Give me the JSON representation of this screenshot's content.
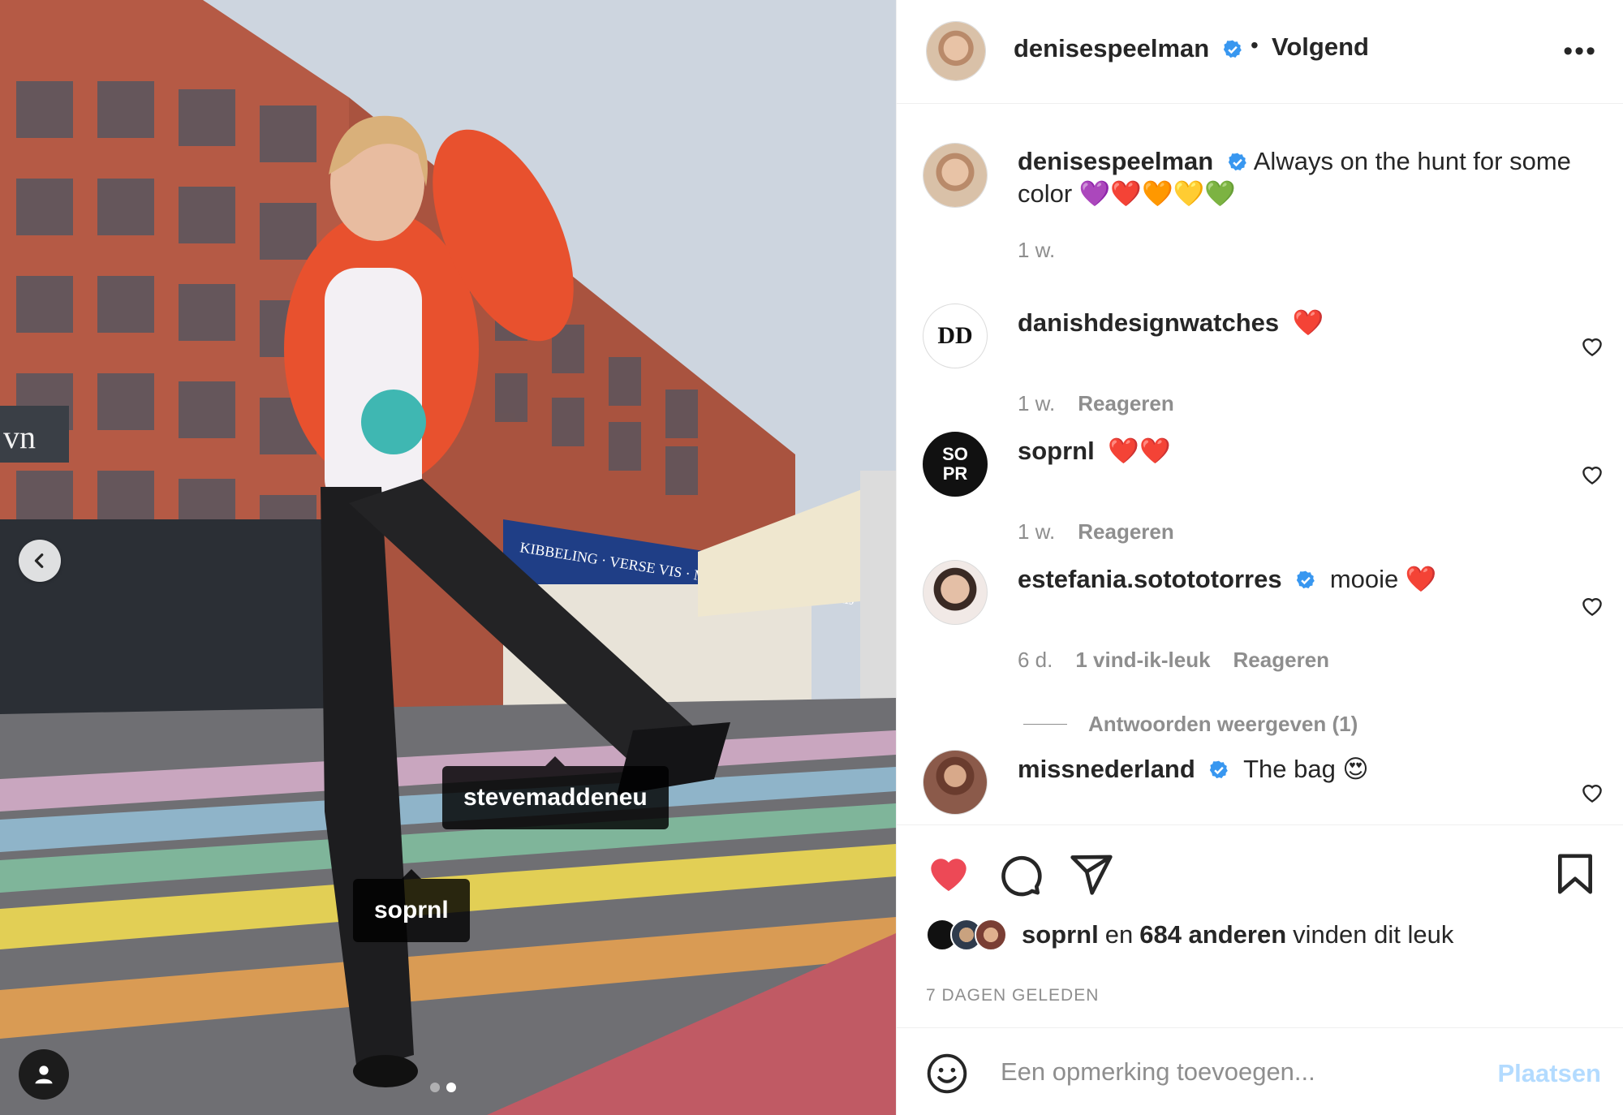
{
  "post": {
    "author": "denisespeelman",
    "follow_label": "Volgend",
    "separator": "•",
    "more_label": "•••",
    "caption_text": "Always on the hunt for some color 💜❤️🧡💛💚",
    "caption_time": "1 w."
  },
  "photo": {
    "tags": [
      "stevemaddeneu",
      "soprnl"
    ],
    "dots_count": 2,
    "active_dot": 2,
    "storefront_text": "KIBBELING · VERSE VIS · MAALTIJDEN · ROKERIJ"
  },
  "comments": [
    {
      "user": "danishdesignwatches",
      "text": "❤️",
      "verified": false,
      "time": "1 w.",
      "likes": "",
      "reply": "Reageren",
      "avatar_text": "DD"
    },
    {
      "user": "soprnl",
      "text": "❤️❤️",
      "verified": false,
      "time": "1 w.",
      "likes": "",
      "reply": "Reageren",
      "avatar_text": "SO PR"
    },
    {
      "user": "estefania.sotototorres",
      "text": "mooie ❤️",
      "verified": true,
      "time": "6 d.",
      "likes": "1 vind-ik-leuk",
      "reply": "Reageren",
      "avatar_text": ""
    },
    {
      "user": "missnederland",
      "text": "The bag 😍",
      "verified": true,
      "time": "",
      "likes": "",
      "reply": "",
      "avatar_text": ""
    }
  ],
  "view_replies": "Antwoorden weergeven (1)",
  "likes": {
    "first_user": "soprnl",
    "connector": "en",
    "others": "684 anderen",
    "suffix": "vinden dit leuk"
  },
  "timestamp": "7 DAGEN GELEDEN",
  "add_comment": {
    "placeholder": "Een opmerking toevoegen...",
    "post_label": "Plaatsen"
  },
  "colors": {
    "like_red": "#ed4956",
    "verified_blue": "#3897f0",
    "post_button_disabled": "#b3dbff",
    "secondary_text": "#8e8e8e"
  }
}
